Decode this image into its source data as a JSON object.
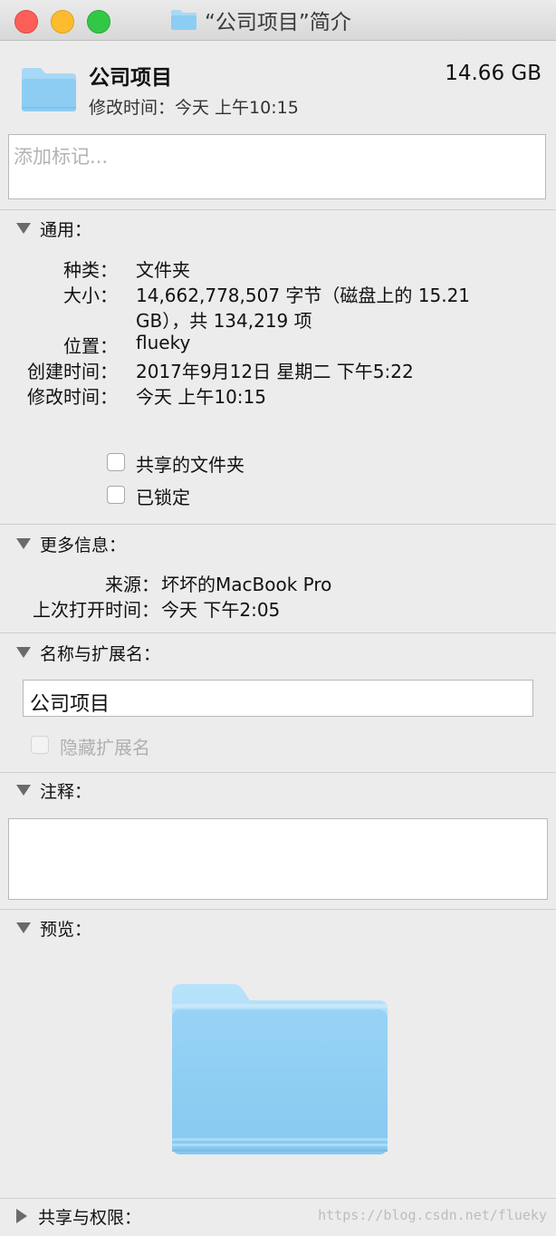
{
  "window": {
    "title": "“公司项目”简介"
  },
  "header": {
    "name": "公司项目",
    "size": "14.66 GB",
    "modified": "修改时间：今天 上午10:15"
  },
  "tags": {
    "placeholder": "添加标记..."
  },
  "general": {
    "heading": "通用：",
    "rows": [
      {
        "key": "种类：",
        "value": "文件夹"
      },
      {
        "key": "大小：",
        "value": "14,662,778,507 字节（磁盘上的 15.21",
        "value2": "GB），共 134,219 项"
      },
      {
        "key": "位置：",
        "value": "flueky"
      },
      {
        "key": "创建时间：",
        "value": "2017年9月12日 星期二 下午5:22"
      },
      {
        "key": "修改时间：",
        "value": "今天 上午10:15"
      }
    ],
    "shared_folder_label": "共享的文件夹",
    "locked_label": "已锁定"
  },
  "more_info": {
    "heading": "更多信息：",
    "rows": [
      {
        "key": "来源：",
        "value": "坏坏的MacBook Pro"
      },
      {
        "key": "上次打开时间：",
        "value": "今天 下午2:05"
      }
    ]
  },
  "name_ext": {
    "heading": "名称与扩展名：",
    "name_value": "公司项目",
    "hide_ext_label": "隐藏扩展名"
  },
  "comments": {
    "heading": "注释："
  },
  "preview": {
    "heading": "预览："
  },
  "sharing": {
    "heading": "共享与权限："
  },
  "watermark": "https://blog.csdn.net/flueky",
  "colors": {
    "folder_light": "#a6d9f7",
    "folder_main": "#8ecdf3",
    "close": "#fc5f57",
    "minimize": "#fdbc2e",
    "zoom": "#33c748"
  }
}
